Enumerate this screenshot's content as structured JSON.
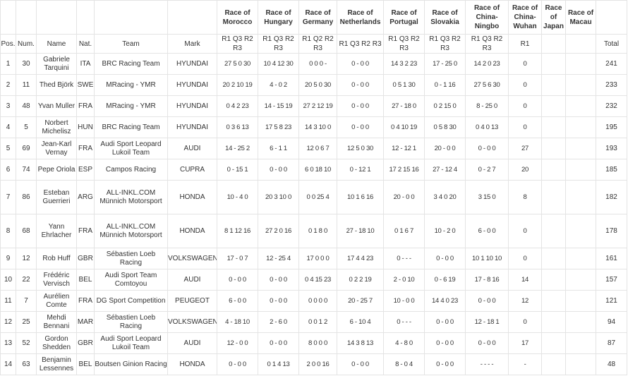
{
  "header": {
    "pos": "Pos.",
    "num": "Num.",
    "name": "Name",
    "nat": "Nat.",
    "team": "Team",
    "mark": "Mark",
    "total": "Total",
    "races": [
      {
        "name": "Race of Morocco",
        "subs": [
          "R1",
          "Q3",
          "R2",
          "R3"
        ]
      },
      {
        "name": "Race of Hungary",
        "subs": [
          "R1",
          "Q3",
          "R2",
          "R3"
        ]
      },
      {
        "name": "Race of Germany",
        "subs": [
          "R1",
          "Q2",
          "R2",
          "R3"
        ]
      },
      {
        "name": "Race of Netherlands",
        "subs": [
          "R1",
          "Q3",
          "R2",
          "R3"
        ]
      },
      {
        "name": "Race of Portugal",
        "subs": [
          "R1",
          "Q3",
          "R2",
          "R3"
        ]
      },
      {
        "name": "Race of Slovakia",
        "subs": [
          "R1",
          "Q3",
          "R2",
          "R3"
        ]
      },
      {
        "name": "Race of China-Ningbo",
        "subs": [
          "R1",
          "Q3",
          "R2",
          "R3"
        ]
      },
      {
        "name": "Race of China-Wuhan",
        "subs": [
          "R1"
        ]
      },
      {
        "name": "Race of Japan",
        "subs": [
          ""
        ]
      },
      {
        "name": "Race of Macau",
        "subs": [
          ""
        ]
      }
    ]
  },
  "rows": [
    {
      "pos": "1",
      "num": "30",
      "name": "Gabriele Tarquini",
      "nat": "ITA",
      "team": "BRC Racing Team",
      "mark": "HYUNDAI",
      "scores": [
        "27 5 0 30",
        "10 4 12 30",
        "0 0 0 -",
        "0 - 0 0",
        "14 3 2 23",
        "17 - 25 0",
        "14 2 0 23",
        "0",
        "",
        ""
      ],
      "total": "241"
    },
    {
      "pos": "2",
      "num": "11",
      "name": "Thed Björk",
      "nat": "SWE",
      "team": "MRacing - YMR",
      "mark": "HYUNDAI",
      "scores": [
        "20 2 10 19",
        "4 - 0 2",
        "20 5 0 30",
        "0 - 0 0",
        "0 5 1 30",
        "0 - 1 16",
        "27 5 6 30",
        "0",
        "",
        ""
      ],
      "total": "233"
    },
    {
      "pos": "3",
      "num": "48",
      "name": "Yvan Muller",
      "nat": "FRA",
      "team": "MRacing - YMR",
      "mark": "HYUNDAI",
      "scores": [
        "0 4 2 23",
        "14 - 15 19",
        "27 2 12 19",
        "0 - 0 0",
        "27 - 18 0",
        "0 2 15 0",
        "8 - 25 0",
        "0",
        "",
        ""
      ],
      "total": "232"
    },
    {
      "pos": "4",
      "num": "5",
      "name": "Norbert Michelisz",
      "nat": "HUN",
      "team": "BRC Racing Team",
      "mark": "HYUNDAI",
      "scores": [
        "0 3 6 13",
        "17 5 8 23",
        "14 3 10 0",
        "0 - 0 0",
        "0 4 10 19",
        "0 5 8 30",
        "0 4 0 13",
        "0",
        "",
        ""
      ],
      "total": "195"
    },
    {
      "pos": "5",
      "num": "69",
      "name": "Jean-Karl Vernay",
      "nat": "FRA",
      "team": "Audi Sport Leopard Lukoil Team",
      "mark": "AUDI",
      "scores": [
        "14 - 25 2",
        "6 - 1 1",
        "12 0 6 7",
        "12 5 0 30",
        "12 - 12 1",
        "20 - 0 0",
        "0 - 0 0",
        "27",
        "",
        ""
      ],
      "total": "193"
    },
    {
      "pos": "6",
      "num": "74",
      "name": "Pepe Oriola",
      "nat": "ESP",
      "team": "Campos Racing",
      "mark": "CUPRA",
      "scores": [
        "0 - 15 1",
        "0 - 0 0",
        "6 0 18 10",
        "0 - 12 1",
        "17 2 15 16",
        "27 - 12 4",
        "0 - 2 7",
        "20",
        "",
        ""
      ],
      "total": "185"
    },
    {
      "pos": "7",
      "num": "86",
      "name": "Esteban Guerrieri",
      "nat": "ARG",
      "team": "ALL-INKL.COM Münnich Motorsport",
      "mark": "HONDA",
      "scores": [
        "10 - 4 0",
        "20 3 10 0",
        "0 0 25 4",
        "10 1 6 16",
        "20 - 0 0",
        "3 4 0 20",
        "3 15 0",
        "8",
        "",
        ""
      ],
      "total": "182",
      "tall": true
    },
    {
      "pos": "8",
      "num": "68",
      "name": "Yann Ehrlacher",
      "nat": "FRA",
      "team": "ALL-INKL.COM Münnich Motorsport",
      "mark": "HONDA",
      "scores": [
        "8 1 12 16",
        "27 2 0 16",
        "0 1 8 0",
        "27 - 18 10",
        "0 1 6 7",
        "10 - 2 0",
        "6 - 0 0",
        "0",
        "",
        ""
      ],
      "total": "178",
      "tall": true
    },
    {
      "pos": "9",
      "num": "12",
      "name": "Rob Huff",
      "nat": "GBR",
      "team": "Sébastien Loeb Racing",
      "mark": "VOLKSWAGEN",
      "scores": [
        "17 - 0 7",
        "12 - 25 4",
        "17 0 0 0",
        "17 4 4 23",
        "0 - - -",
        "0 - 0 0",
        "10 1 10 10",
        "0",
        "",
        ""
      ],
      "total": "161"
    },
    {
      "pos": "10",
      "num": "22",
      "name": "Frédéric Vervisch",
      "nat": "BEL",
      "team": "Audi Sport Team Comtoyou",
      "mark": "AUDI",
      "scores": [
        "0 - 0 0",
        "0 - 0 0",
        "0 4 15 23",
        "0 2 2 19",
        "2 - 0 10",
        "0 - 6 19",
        "17 - 8 16",
        "14",
        "",
        ""
      ],
      "total": "157"
    },
    {
      "pos": "11",
      "num": "7",
      "name": "Aurélien Comte",
      "nat": "FRA",
      "team": "DG Sport Competition",
      "mark": "PEUGEOT",
      "scores": [
        "6 - 0 0",
        "0 - 0 0",
        "0 0 0 0",
        "20 - 25 7",
        "10 - 0 0",
        "14 4 0 23",
        "0 - 0 0",
        "12",
        "",
        ""
      ],
      "total": "121"
    },
    {
      "pos": "12",
      "num": "25",
      "name": "Mehdi Bennani",
      "nat": "MAR",
      "team": "Sébastien Loeb Racing",
      "mark": "VOLKSWAGEN",
      "scores": [
        "4 - 18 10",
        "2 - 6 0",
        "0 0 1 2",
        "6 - 10 4",
        "0 - - -",
        "0 - 0 0",
        "12 - 18 1",
        "0",
        "",
        ""
      ],
      "total": "94"
    },
    {
      "pos": "13",
      "num": "52",
      "name": "Gordon Shedden",
      "nat": "GBR",
      "team": "Audi Sport Leopard Lukoil Team",
      "mark": "AUDI",
      "scores": [
        "12 - 0 0",
        "0 - 0 0",
        "8 0 0 0",
        "14 3 8 13",
        "4 - 8 0",
        "0 - 0 0",
        "0 - 0 0",
        "17",
        "",
        ""
      ],
      "total": "87"
    },
    {
      "pos": "14",
      "num": "63",
      "name": "Benjamin Lessennes",
      "nat": "BEL",
      "team": "Boutsen Ginion Racing",
      "mark": "HONDA",
      "scores": [
        "0 - 0 0",
        "0 1 4 13",
        "2 0 0 16",
        "0 - 0 0",
        "8 - 0 4",
        "0 - 0 0",
        "- - - -",
        "-",
        "",
        ""
      ],
      "total": "48"
    }
  ]
}
